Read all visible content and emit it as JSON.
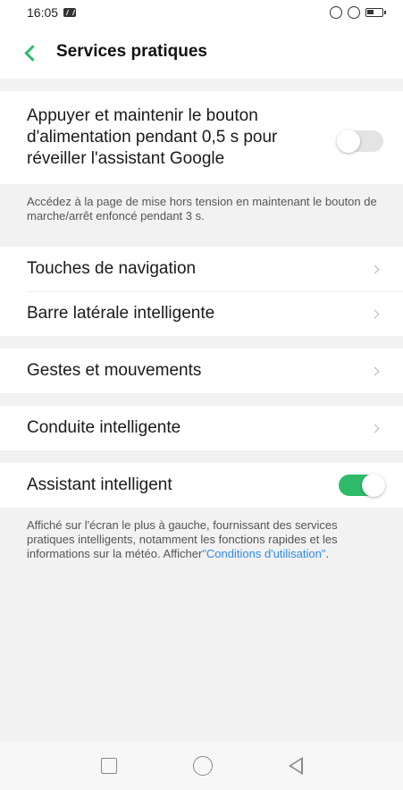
{
  "status_bar": {
    "time": "16:05"
  },
  "header": {
    "title": "Services pratiques"
  },
  "power_button": {
    "label": "Appuyer et maintenir le bouton d'alimentation pendant 0,5 s pour réveiller l'assistant Google",
    "enabled": false,
    "description": "Accédez à la page de mise hors tension en maintenant le bouton de marche/arrêt enfoncé pendant 3 s."
  },
  "menu_group_1": [
    {
      "label": "Touches de navigation"
    },
    {
      "label": "Barre latérale intelligente"
    }
  ],
  "menu_group_2": [
    {
      "label": "Gestes et mouvements"
    }
  ],
  "menu_group_3": [
    {
      "label": "Conduite intelligente"
    }
  ],
  "smart_assistant": {
    "label": "Assistant intelligent",
    "enabled": true,
    "description": "Affiché sur l'écran le plus à gauche, fournissant des services pratiques intelligents, notamment les fonctions rapides et les informations sur la météo. Afficher",
    "link": "\"Conditions d'utilisation\"",
    "suffix": "."
  },
  "colors": {
    "accent": "#2ebb6a",
    "link": "#2e8be6",
    "background": "#f2f2f2"
  }
}
